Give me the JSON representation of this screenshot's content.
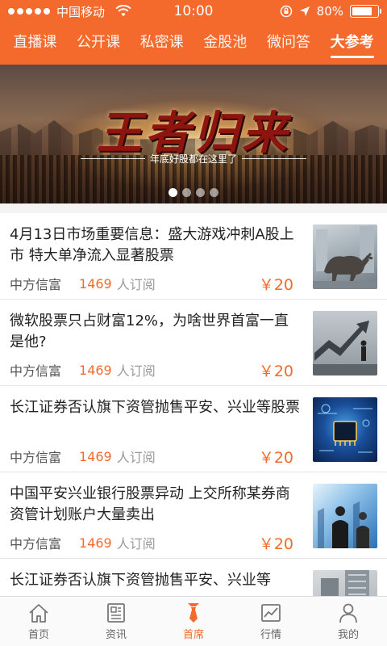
{
  "status_bar": {
    "carrier": "中国移动",
    "time": "10:00",
    "battery": "80%",
    "battery_level": 0.8,
    "icons": [
      "signal-icon",
      "wifi-icon",
      "rotation-lock-icon",
      "location-icon",
      "battery-icon"
    ]
  },
  "tabs": [
    {
      "label": "直播课",
      "active": false
    },
    {
      "label": "公开课",
      "active": false
    },
    {
      "label": "私密课",
      "active": false
    },
    {
      "label": "金股池",
      "active": false
    },
    {
      "label": "微问答",
      "active": false
    },
    {
      "label": "大参考",
      "active": true
    }
  ],
  "banner": {
    "title": "王者归来",
    "subtitle": "年底好股都在这里了",
    "page_count": 4,
    "active_index": 0
  },
  "articles": [
    {
      "title": "4月13日市场重要信息：盛大游戏冲刺A股上市 特大单净流入显著股票",
      "source": "中方信富",
      "count": "1469",
      "subscribe_label": "人订阅",
      "price": "￥20",
      "thumb": "bull-statue-image"
    },
    {
      "title": "微软股票只占财富12%，为啥世界首富一直是他?",
      "source": "中方信富",
      "count": "1469",
      "subscribe_label": "人订阅",
      "price": "￥20",
      "thumb": "rising-arrow-image"
    },
    {
      "title": "长江证券否认旗下资管抛售平安、兴业等股票",
      "source": "中方信富",
      "count": "1469",
      "subscribe_label": "人订阅",
      "price": "￥20",
      "thumb": "chip-circuit-image"
    },
    {
      "title": "中国平安兴业银行股票异动 上交所称某券商资管计划账户大量卖出",
      "source": "中方信富",
      "count": "1469",
      "subscribe_label": "人订阅",
      "price": "￥20",
      "thumb": "business-people-image"
    },
    {
      "title": "长江证券否认旗下资管抛售平安、兴业等",
      "source": "",
      "count": "",
      "subscribe_label": "",
      "price": "",
      "thumb": "building-image"
    }
  ],
  "bottom_nav": [
    {
      "label": "首页",
      "icon": "home-icon",
      "active": false
    },
    {
      "label": "资讯",
      "icon": "news-icon",
      "active": false
    },
    {
      "label": "首席",
      "icon": "tie-icon",
      "active": true
    },
    {
      "label": "行情",
      "icon": "chart-icon",
      "active": false
    },
    {
      "label": "我的",
      "icon": "user-icon",
      "active": false
    }
  ],
  "colors": {
    "brand": "#f46a2c",
    "text": "#222222",
    "muted": "#999999"
  }
}
